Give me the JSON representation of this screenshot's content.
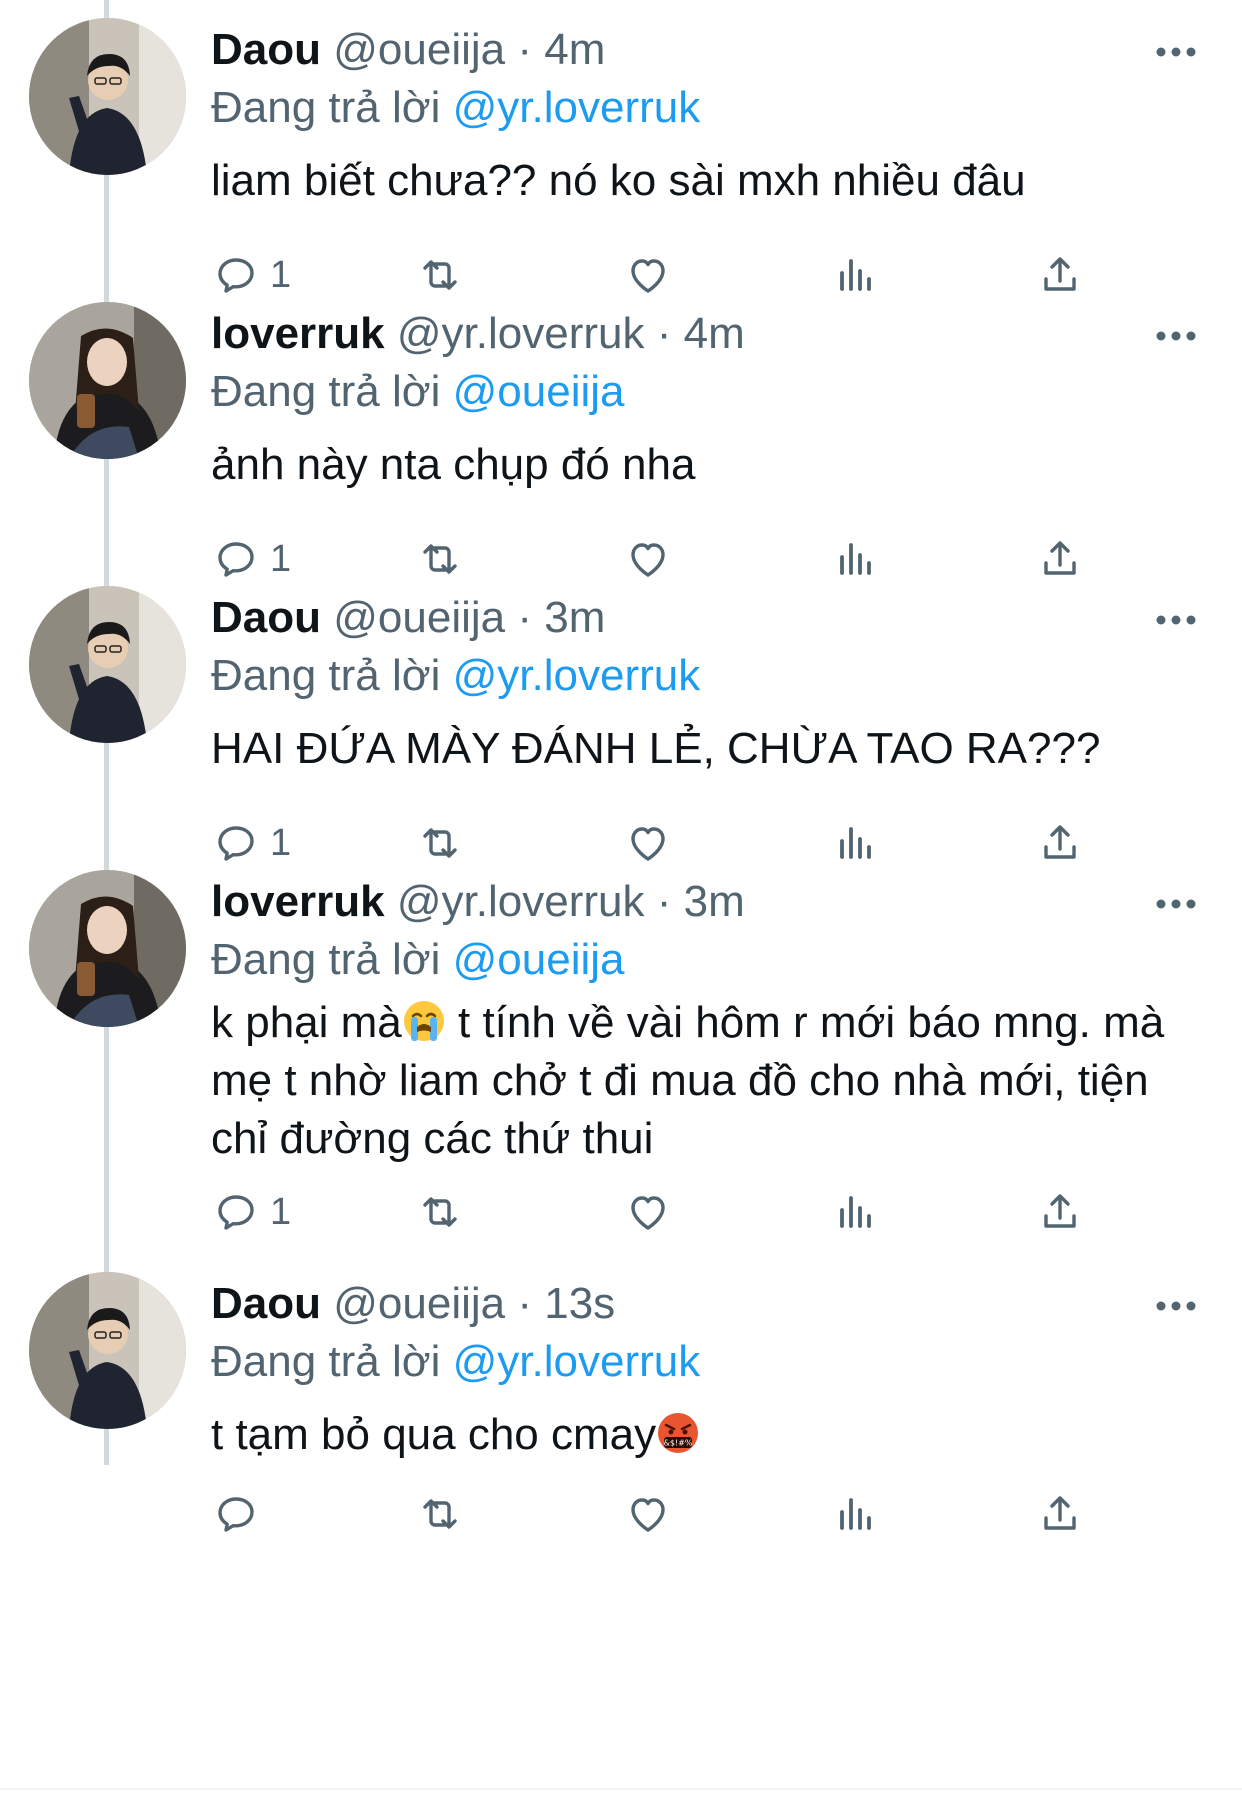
{
  "tweets": [
    {
      "name": "Daou",
      "handle": "@oueiija",
      "separator": "·",
      "time": "4m",
      "reply_prefix": "Đang trả lời",
      "reply_to": "@yr.loverruk",
      "text_parts": [
        "liam biết chưa?? nó ko sài mxh nhiều đâu"
      ],
      "reply_count": "1",
      "avatar": "avatar-daou"
    },
    {
      "name": "loverruk",
      "handle": "@yr.loverruk",
      "separator": "·",
      "time": "4m",
      "reply_prefix": "Đang trả lời",
      "reply_to": "@oueiija",
      "text_parts": [
        "ảnh này nta chụp đó nha"
      ],
      "reply_count": "1",
      "avatar": "avatar-loverruk"
    },
    {
      "name": "Daou",
      "handle": "@oueiija",
      "separator": "·",
      "time": "3m",
      "reply_prefix": "Đang trả lời",
      "reply_to": "@yr.loverruk",
      "text_parts": [
        "HAI ĐỨA MÀY ĐÁNH LẺ, CHỪA TAO RA???"
      ],
      "reply_count": "1",
      "avatar": "avatar-daou"
    },
    {
      "name": "loverruk",
      "handle": "@yr.loverruk",
      "separator": "·",
      "time": "3m",
      "reply_prefix": "Đang trả lời",
      "reply_to": "@oueiija",
      "text_parts": [
        "k phại mà",
        "  t tính về vài hôm r mới báo mng. mà mẹ t nhờ liam chở t đi mua đồ cho nhà mới, tiện chỉ đường các thứ thui"
      ],
      "emoji": "loudly-crying-face",
      "reply_count": "1",
      "avatar": "avatar-loverruk"
    },
    {
      "name": "Daou",
      "handle": "@oueiija",
      "separator": "·",
      "time": "13s",
      "reply_prefix": "Đang trả lời",
      "reply_to": "@yr.loverruk",
      "text_parts": [
        "t tạm bỏ qua cho cmay"
      ],
      "emoji": "face-with-symbols-on-mouth",
      "emoji_symbols": "&$!#%",
      "reply_count": "",
      "avatar": "avatar-daou"
    }
  ],
  "icons": {
    "reply": "reply-icon",
    "retweet": "retweet-icon",
    "like": "like-icon",
    "views": "views-icon",
    "share": "share-icon",
    "more": "more-icon"
  },
  "colors": {
    "text": "#0f1419",
    "secondary": "#536471",
    "mention": "#1d9bf0",
    "thread_line": "#cfd9de"
  }
}
